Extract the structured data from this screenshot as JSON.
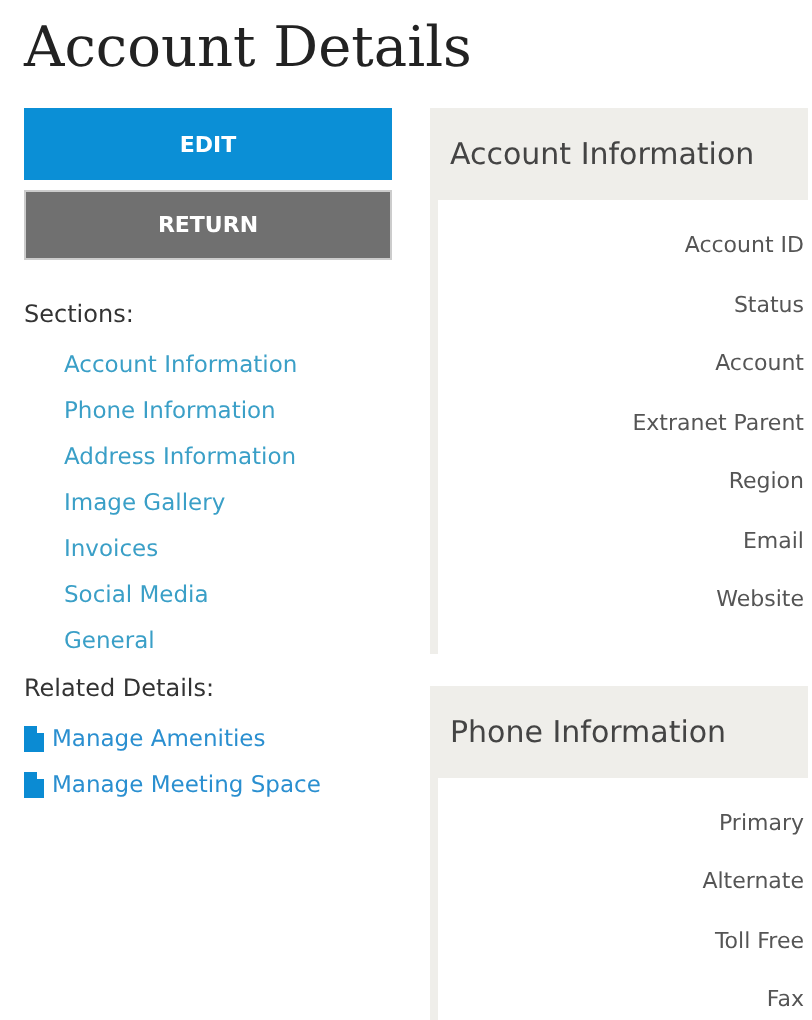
{
  "title": "Account Details",
  "buttons": [
    {
      "label": "EDIT",
      "kind": "primary"
    },
    {
      "label": "RETURN",
      "kind": "secondary"
    }
  ],
  "sections_label": "Sections:",
  "sections": [
    "Account Information",
    "Phone Information",
    "Address Information",
    "Image Gallery",
    "Invoices",
    "Social Media",
    "General"
  ],
  "related_label": "Related Details:",
  "related": [
    "Manage Amenities",
    "Manage Meeting Space"
  ],
  "panels": [
    {
      "title": "Account Information",
      "fields": [
        "Account ID",
        "Status",
        "Account",
        "Extranet Parent",
        "Region",
        "Email",
        "Website"
      ]
    },
    {
      "title": "Phone Information",
      "fields": [
        "Primary",
        "Alternate",
        "Toll Free",
        "Fax"
      ]
    }
  ]
}
